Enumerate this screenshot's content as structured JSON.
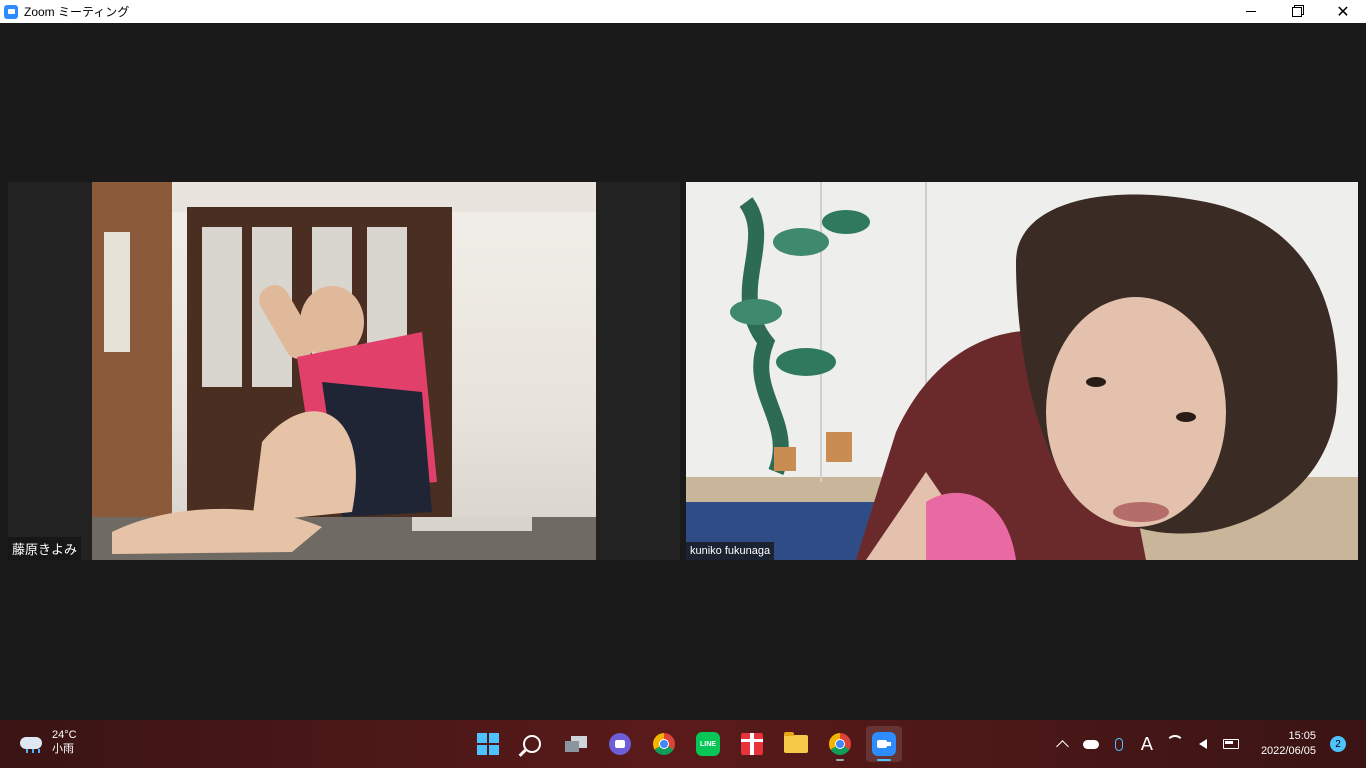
{
  "window": {
    "title": "Zoom ミーティング"
  },
  "participants": [
    {
      "name": "藤原きよみ"
    },
    {
      "name": "kuniko fukunaga"
    }
  ],
  "taskbar": {
    "weather": {
      "temp": "24°C",
      "condition": "小雨"
    },
    "apps": [
      "start",
      "search",
      "task-view",
      "chat",
      "chrome",
      "line",
      "gift",
      "file-explorer",
      "chrome",
      "zoom"
    ],
    "line_label": "LINE",
    "tray": {
      "ime": "A"
    },
    "clock": {
      "time": "15:05",
      "date": "2022/06/05"
    },
    "notifications": "2"
  }
}
